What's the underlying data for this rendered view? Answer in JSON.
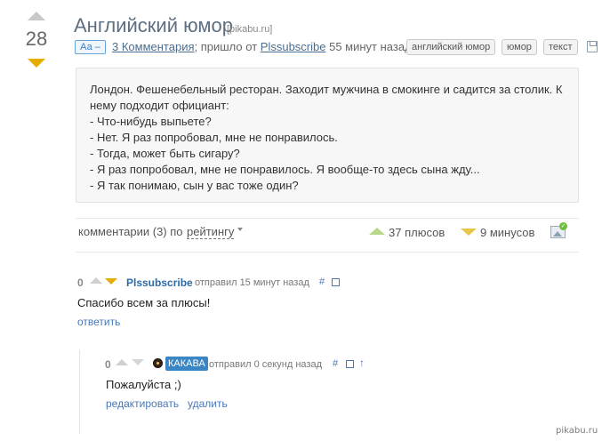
{
  "post": {
    "rating": "28",
    "title": "Английский юмор",
    "source": "[pikabu.ru]",
    "font_toggle": "Аа –",
    "comments_link": "3 Комментария",
    "meta_middle": "; пришло от ",
    "author": "Plssubscribe",
    "time": " 55 минут назад",
    "tags": [
      "английский юмор",
      "юмор",
      "текст"
    ],
    "story_lines": [
      "Лондон. Фешенебельный ресторан. Заходит мужчина в смокинге и садится за столик. К",
      "нему подходит официант:",
      "- Что-нибудь выпьете?",
      "- Нет. Я раз попробовал, мне не понравилось.",
      "- Тогда, может быть сигару?",
      "- Я раз попробовал, мне не понравилось. Я вообще-то здесь сына жду...",
      "- Я так понимаю, сын у вас тоже один?"
    ]
  },
  "comments_bar": {
    "label": "комментарии (3) по",
    "sort": "рейтингу",
    "plus": "37 плюсов",
    "minus": "9 минусов"
  },
  "comments": [
    {
      "rating": "0",
      "author": "Plssubscribe",
      "meta": "отправил 15 минут назад",
      "hash": "#",
      "text": "Спасибо всем за плюсы!",
      "reply": "ответить"
    },
    {
      "rating": "0",
      "author": "КАКАВА",
      "meta": "отправил 0 секунд назад",
      "hash": "#",
      "parent": "↑",
      "text": "Пожалуйста ;)",
      "edit": "редактировать",
      "delete": "удалить"
    }
  ],
  "watermark": "pikabu.ru",
  "colors": {
    "title": "#5d6f80",
    "link": "#4a77b4",
    "vote_down": "#e4ad00",
    "plus": "#b9d98a",
    "badge": "#3a86c4"
  }
}
